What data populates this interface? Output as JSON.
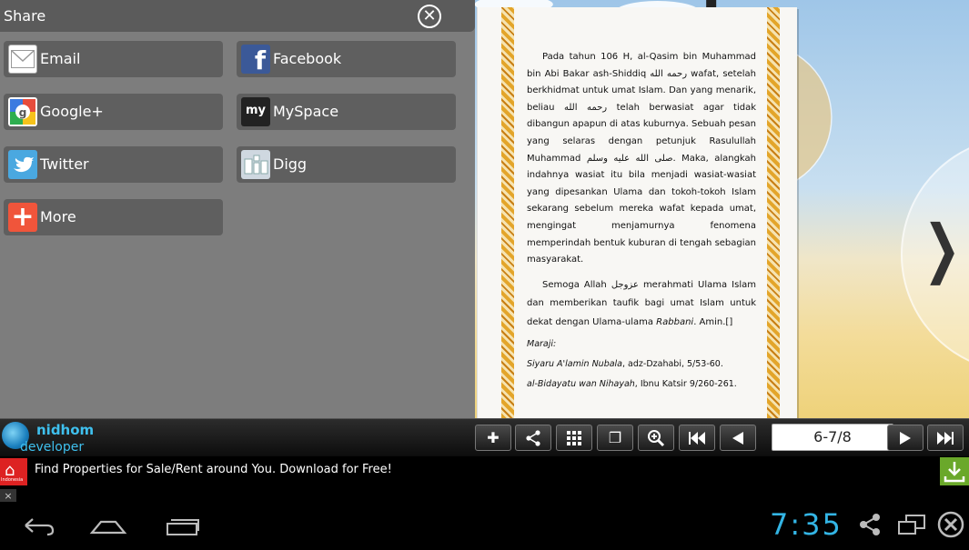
{
  "share": {
    "title": "Share",
    "close_icon": "close-icon",
    "items": [
      {
        "label": "Email",
        "icon": "email-icon"
      },
      {
        "label": "Facebook",
        "icon": "facebook-icon"
      },
      {
        "label": "Google+",
        "icon": "google-plus-icon"
      },
      {
        "label": "MySpace",
        "icon": "myspace-icon"
      },
      {
        "label": "Twitter",
        "icon": "twitter-icon"
      },
      {
        "label": "Digg",
        "icon": "digg-icon"
      },
      {
        "label": "More",
        "icon": "more-icon"
      }
    ]
  },
  "book_page": {
    "para1": "Pada tahun 106 H, al-Qasim bin Muhammad bin Abi Bakar ash-Shiddiq رحمه الله wafat, setelah berkhidmat untuk umat Islam. Dan yang menarik, beliau رحمه الله telah berwasiat agar tidak dibangun apapun di atas kuburnya. Sebuah pesan yang selaras dengan petunjuk Rasulullah Muhammad صلى الله عليه وسلم. Maka, alangkah indahnya wasiat itu bila menjadi wasiat-wasiat yang dipesankan Ulama dan tokoh-tokoh Islam sekarang sebelum mereka wafat kepada umat, mengingat menjamurnya fenomena memperindah bentuk kuburan di tengah sebagian masyarakat.",
    "para2_a": "Semoga Allah عزوجل merahmati Ulama Islam dan memberikan taufik bagi umat Islam untuk dekat dengan Ulama-ulama ",
    "para2_em": "Rabbani",
    "para2_b": ". Amin.[]",
    "refs_title": "Maraji:",
    "ref1_title": "Siyaru A'lamin Nubala",
    "ref1_rest": ", adz-Dzahabi, 5/53-60.",
    "ref2_title": "al-Bidayatu wan Nihayah",
    "ref2_rest": ", Ibnu Katsir 9/260-261."
  },
  "reader": {
    "next_arrow": "❯"
  },
  "toolbar": {
    "brand_line1": "nidhom",
    "brand_line2": "developer",
    "page_indicator": "6-7/8",
    "buttons": [
      {
        "name": "bookmark-add-button",
        "icon": "pin-icon",
        "glyph": "✚"
      },
      {
        "name": "share-button",
        "icon": "share-icon",
        "glyph": "⋖"
      },
      {
        "name": "thumbnails-button",
        "icon": "grid-icon",
        "glyph": "▦"
      },
      {
        "name": "view-mode-button",
        "icon": "pages-icon",
        "glyph": "❐"
      },
      {
        "name": "zoom-button",
        "icon": "zoom-in-icon",
        "glyph": "⊕"
      },
      {
        "name": "first-page-button",
        "icon": "first-page-icon",
        "glyph": "⏮"
      },
      {
        "name": "prev-page-button",
        "icon": "prev-icon",
        "glyph": "◀"
      },
      {
        "name": "next-page-button",
        "icon": "next-icon",
        "glyph": "▶"
      },
      {
        "name": "last-page-button",
        "icon": "last-page-icon",
        "glyph": "⏭"
      }
    ]
  },
  "ad": {
    "icon_caption": "Indonesia",
    "text": "Find Properties for Sale/Rent around You. Download for Free!",
    "close": "×"
  },
  "system": {
    "time": "7:35"
  },
  "colors": {
    "accent_clock": "#33b5e5",
    "facebook": "#3b5998",
    "twitter": "#4aa8e0",
    "more": "#f0553b",
    "ad_download": "#6aa82a"
  }
}
